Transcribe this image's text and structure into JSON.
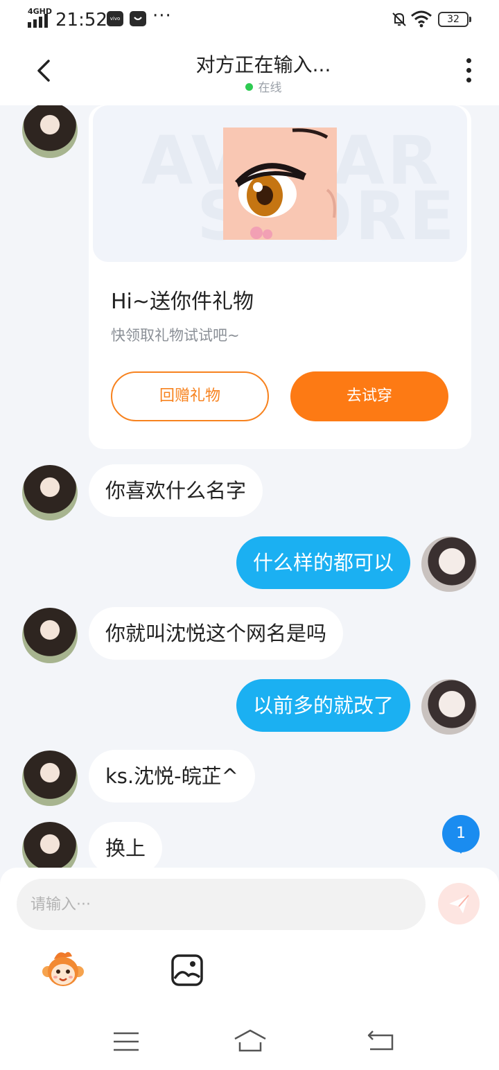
{
  "status_bar": {
    "network": "4GHD",
    "time": "21:52",
    "app_badge": "vivo",
    "overflow": "···",
    "battery": "32",
    "icons": [
      "signal-icon",
      "bell-off-icon",
      "wifi-icon",
      "battery-icon"
    ]
  },
  "header": {
    "title": "对方正在输入...",
    "status": "在线",
    "icons": [
      "back-arrow-icon",
      "more-vertical-icon"
    ]
  },
  "gift_card": {
    "title": "Hi~送你件礼物",
    "subtitle": "快领取礼物试试吧~",
    "return_button": "回赠礼物",
    "try_button": "去试穿",
    "image_icon": "anime-eye-image"
  },
  "messages": [
    {
      "from": "other",
      "text": "你喜欢什么名字"
    },
    {
      "from": "me",
      "text": "什么样的都可以"
    },
    {
      "from": "other",
      "text": "你就叫沈悦这个网名是吗"
    },
    {
      "from": "me",
      "text": "以前多的就改了"
    },
    {
      "from": "other",
      "text": "ks.沈悦-皖芷^"
    },
    {
      "from": "other",
      "text": "换上"
    }
  ],
  "unread_badge": "1",
  "input": {
    "placeholder": "请输入···",
    "icons": [
      "send-icon",
      "monkey-emoji-icon",
      "image-icon"
    ]
  },
  "nav": {
    "icons": [
      "menu-icon",
      "home-icon",
      "back-icon"
    ]
  },
  "colors": {
    "accent_orange": "#fd7a14",
    "outgoing_bubble": "#1bb0f2",
    "online": "#2ecb52",
    "badge": "#1a8cf0",
    "background": "#f3f5f9"
  }
}
